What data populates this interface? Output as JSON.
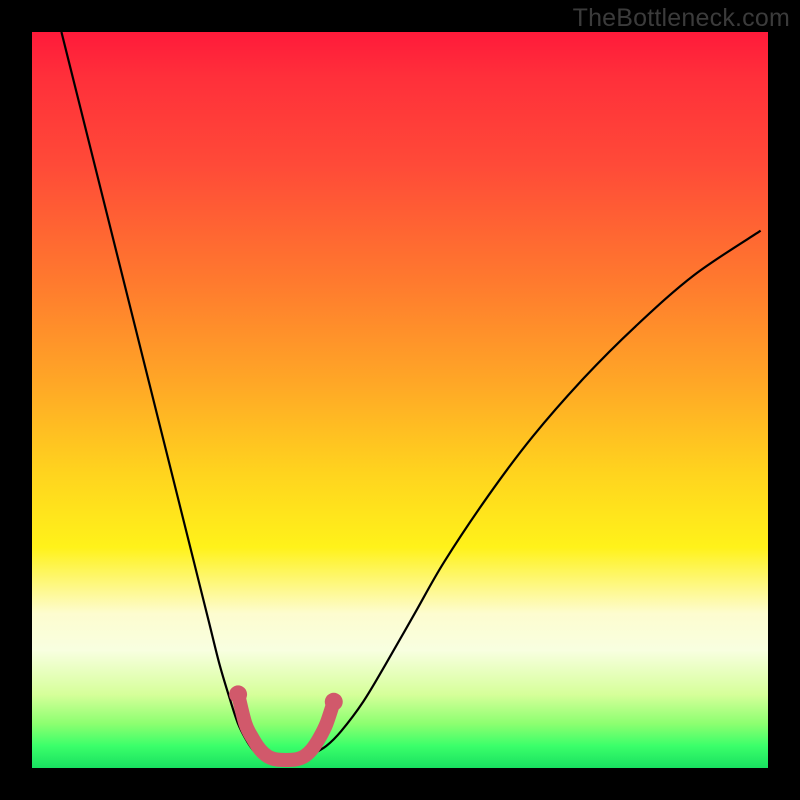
{
  "watermark": "TheBottleneck.com",
  "chart_data": {
    "type": "line",
    "title": "",
    "xlabel": "",
    "ylabel": "",
    "xlim": [
      0,
      100
    ],
    "ylim": [
      0,
      100
    ],
    "grid": false,
    "legend": false,
    "series": [
      {
        "name": "left-curve",
        "x": [
          4,
          6,
          8,
          10,
          12,
          14,
          16,
          18,
          20,
          22,
          24,
          25.5,
          27,
          28,
          29,
          30,
          31
        ],
        "y": [
          100,
          92,
          84,
          76,
          68,
          60,
          52,
          44,
          36,
          28,
          20,
          14,
          9,
          6,
          4,
          2.5,
          1.8
        ]
      },
      {
        "name": "right-curve",
        "x": [
          38,
          40,
          42,
          45,
          48,
          52,
          56,
          62,
          68,
          75,
          82,
          90,
          99
        ],
        "y": [
          1.8,
          3,
          5,
          9,
          14,
          21,
          28,
          37,
          45,
          53,
          60,
          67,
          73
        ]
      },
      {
        "name": "bottom-flat",
        "x": [
          31,
          32,
          33,
          34,
          35,
          36,
          37,
          38
        ],
        "y": [
          1.8,
          1.4,
          1.2,
          1.1,
          1.1,
          1.2,
          1.4,
          1.8
        ]
      }
    ],
    "highlight": {
      "name": "optimal-region",
      "color": "#d1596b",
      "x": [
        28,
        29,
        30,
        31,
        32,
        33,
        34,
        35,
        36,
        37,
        38,
        39,
        40,
        41
      ],
      "y": [
        10,
        6,
        4,
        2.5,
        1.6,
        1.2,
        1.1,
        1.1,
        1.2,
        1.6,
        2.5,
        4,
        6,
        9
      ],
      "dots_x": [
        28,
        41
      ],
      "dots_y": [
        10,
        9
      ]
    },
    "background_gradient": {
      "top": "#ff1a3a",
      "mid_upper": "#ff7a2e",
      "mid": "#ffd41e",
      "mid_lower": "#fdfccf",
      "bottom": "#18e060"
    }
  }
}
